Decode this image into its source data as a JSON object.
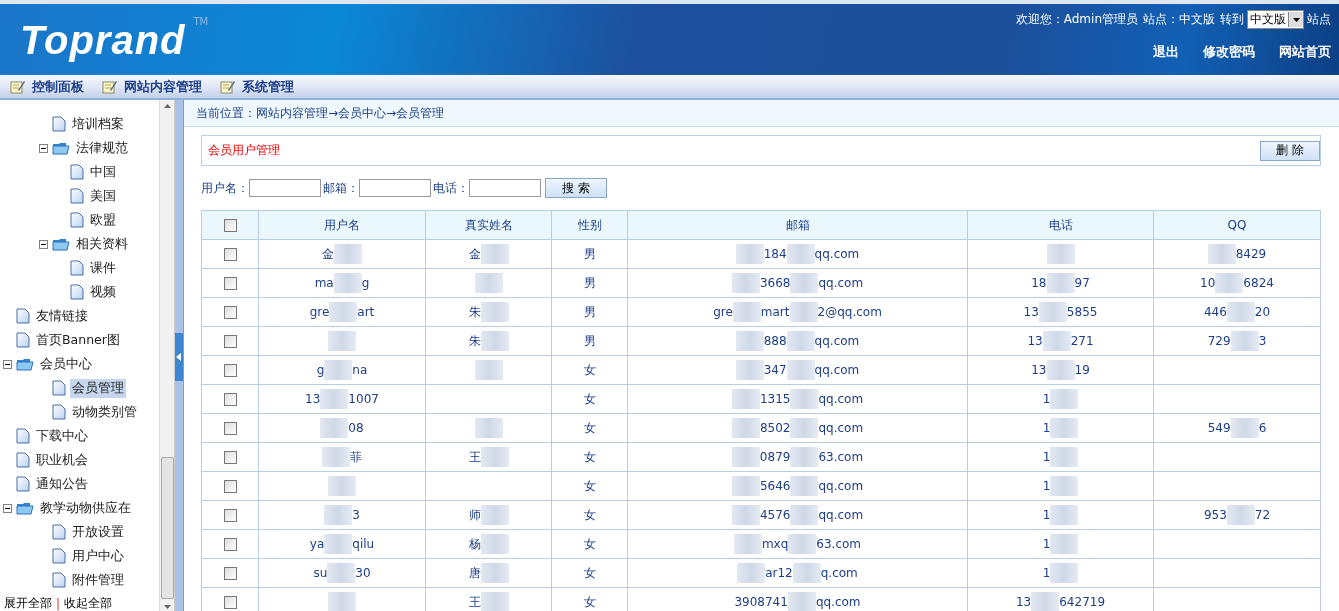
{
  "header": {
    "logo": "Toprand",
    "trademark": "TM",
    "welcome": "欢迎您：",
    "user": "Admin管理员",
    "site_label": "站点：中文版",
    "goto": "转到",
    "site_select": "中文版",
    "site_suffix": "站点",
    "links": [
      "退出",
      "修改密码",
      "网站首页"
    ]
  },
  "nav": {
    "items": [
      {
        "label": "控制面板"
      },
      {
        "label": "网站内容管理"
      },
      {
        "label": "系统管理"
      }
    ]
  },
  "tree": [
    {
      "children": [
        {
          "label": "培训档案",
          "selected": false
        },
        {
          "label": "法律规范",
          "expanded": true,
          "children": [
            {
              "label": "中国",
              "selected": false
            },
            {
              "label": "美国",
              "selected": false
            },
            {
              "label": "欧盟",
              "selected": false
            }
          ]
        },
        {
          "label": "相关资料",
          "expanded": true,
          "children": [
            {
              "label": "课件",
              "selected": false
            },
            {
              "label": "视频",
              "selected": false
            }
          ]
        }
      ]
    },
    {
      "label": "友情链接",
      "selected": false
    },
    {
      "label": "首页Banner图",
      "selected": false
    },
    {
      "label": "会员中心",
      "expanded": true,
      "children": [
        {
          "label": "会员管理",
          "selected": true
        },
        {
          "label": "动物类别管",
          "selected": false
        }
      ]
    },
    {
      "label": "下载中心",
      "selected": false
    },
    {
      "label": "职业机会",
      "selected": false
    },
    {
      "label": "通知公告",
      "selected": false
    },
    {
      "label": "教学动物供应在",
      "expanded": true,
      "children": [
        {
          "label": "开放设置",
          "selected": false
        },
        {
          "label": "用户中心",
          "selected": false
        },
        {
          "label": "附件管理",
          "selected": false
        }
      ]
    }
  ],
  "tree_footer": {
    "expand_all": "展开全部",
    "separator": "|",
    "collapse_all": "收起全部"
  },
  "breadcrumb": "当前位置：网站内容管理→会员中心→会员管理",
  "panel": {
    "title": "会员用户管理",
    "delete_button": "删 除"
  },
  "search": {
    "fields": [
      {
        "label": "用户名："
      },
      {
        "label": "邮箱："
      },
      {
        "label": "电话："
      }
    ],
    "button": "搜 索"
  },
  "table": {
    "select_all_checked": false,
    "columns": [
      "用户名",
      "真实姓名",
      "性别",
      "邮箱",
      "电话",
      "QQ"
    ],
    "rows": [
      {
        "checked": false,
        "cells": [
          [
            "金",
            null
          ],
          [
            "金",
            null
          ],
          [
            "男"
          ],
          [
            null,
            "184",
            null,
            "qq.com"
          ],
          [
            null
          ],
          [
            null,
            "8429"
          ]
        ]
      },
      {
        "checked": false,
        "cells": [
          [
            "ma",
            null,
            "g"
          ],
          [
            null
          ],
          [
            "男"
          ],
          [
            null,
            "3668",
            null,
            "qq.com"
          ],
          [
            "18",
            null,
            "97"
          ],
          [
            "10",
            null,
            "6824"
          ]
        ]
      },
      {
        "checked": false,
        "cells": [
          [
            "gre",
            null,
            "art"
          ],
          [
            "朱",
            null
          ],
          [
            "男"
          ],
          [
            "gre",
            null,
            "mart",
            null,
            "2@qq.com"
          ],
          [
            "13",
            null,
            "5855"
          ],
          [
            "446",
            null,
            "20"
          ]
        ]
      },
      {
        "checked": false,
        "cells": [
          [
            null
          ],
          [
            "朱",
            null
          ],
          [
            "男"
          ],
          [
            null,
            "888",
            null,
            "qq.com"
          ],
          [
            "13",
            null,
            "271"
          ],
          [
            "729",
            null,
            "3"
          ]
        ]
      },
      {
        "checked": false,
        "cells": [
          [
            "g",
            null,
            "na"
          ],
          [
            null
          ],
          [
            "女"
          ],
          [
            null,
            "347",
            null,
            "qq.com"
          ],
          [
            "13",
            null,
            "19"
          ],
          null
        ]
      },
      {
        "checked": false,
        "cells": [
          [
            "13",
            null,
            "1007"
          ],
          null,
          [
            "女"
          ],
          [
            null,
            "1315",
            null,
            "qq.com"
          ],
          [
            "1",
            null
          ],
          null
        ]
      },
      {
        "checked": false,
        "cells": [
          [
            null,
            "08"
          ],
          [
            null
          ],
          [
            "女"
          ],
          [
            null,
            "8502",
            null,
            "qq.com"
          ],
          [
            "1",
            null
          ],
          [
            "549",
            null,
            "6"
          ]
        ]
      },
      {
        "checked": false,
        "cells": [
          [
            null,
            "菲"
          ],
          [
            "王",
            null
          ],
          [
            "女"
          ],
          [
            null,
            "0879",
            null,
            "63.com"
          ],
          [
            "1",
            null
          ],
          null
        ]
      },
      {
        "checked": false,
        "cells": [
          [
            null
          ],
          null,
          [
            "女"
          ],
          [
            null,
            "5646",
            null,
            "qq.com"
          ],
          [
            "1",
            null
          ],
          null
        ]
      },
      {
        "checked": false,
        "cells": [
          [
            null,
            "3"
          ],
          [
            "师",
            null
          ],
          [
            "女"
          ],
          [
            null,
            "4576",
            null,
            "qq.com"
          ],
          [
            "1",
            null
          ],
          [
            "953",
            null,
            "72"
          ]
        ]
      },
      {
        "checked": false,
        "cells": [
          [
            "ya",
            null,
            "qilu"
          ],
          [
            "杨",
            null
          ],
          [
            "女"
          ],
          [
            null,
            "mxq",
            null,
            "63.com"
          ],
          [
            "1",
            null
          ],
          null
        ]
      },
      {
        "checked": false,
        "cells": [
          [
            "su",
            null,
            "30"
          ],
          [
            "唐",
            null
          ],
          [
            "女"
          ],
          [
            null,
            "ar12",
            null,
            "q.com"
          ],
          [
            "1",
            null
          ],
          null
        ]
      },
      {
        "checked": false,
        "cells": [
          [
            null
          ],
          [
            "王",
            null
          ],
          [
            "女"
          ],
          [
            "3908741",
            null,
            "qq.com"
          ],
          [
            "13",
            null,
            "642719"
          ],
          null
        ]
      }
    ]
  }
}
